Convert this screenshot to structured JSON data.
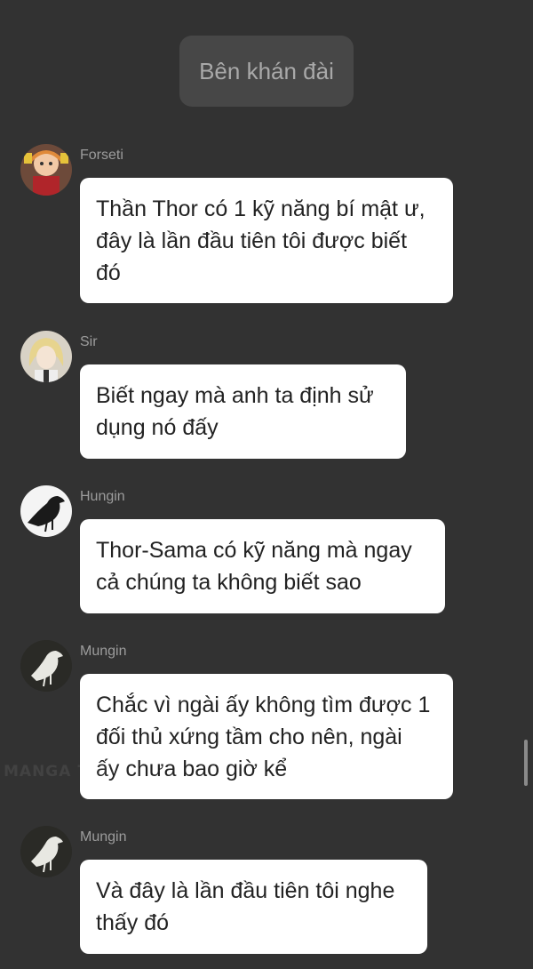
{
  "header": {
    "title": "Bên khán đài"
  },
  "watermark": "MANGA TOON",
  "messages": [
    {
      "sender": "Forseti",
      "text": "Thần Thor có 1 kỹ năng bí mật ư,\nđây là lần đầu tiên tôi được biết\nđó",
      "avatar_icon": "anime-character-avatar-icon"
    },
    {
      "sender": "Sir",
      "text": "Biết ngay mà anh ta định sử\ndụng nó đấy",
      "avatar_icon": "blonde-character-avatar-icon"
    },
    {
      "sender": "Hungin",
      "text": "Thor-Sama có kỹ năng mà ngay\ncả chúng ta không biết sao",
      "avatar_icon": "black-raven-avatar-icon"
    },
    {
      "sender": "Mungin",
      "text": "Chắc vì ngài ấy không tìm được 1\nđối thủ xứng tầm cho nên, ngài\nấy chưa bao giờ kể",
      "avatar_icon": "white-raven-avatar-icon"
    },
    {
      "sender": "Mungin",
      "text": "Và đây là lần đầu tiên tôi nghe\nthấy đó",
      "avatar_icon": "white-raven-avatar-icon"
    }
  ],
  "colors": {
    "background": "#323232",
    "bubble": "#ffffff",
    "header_pill": "#474747",
    "sender_text": "#9c9c9c"
  }
}
